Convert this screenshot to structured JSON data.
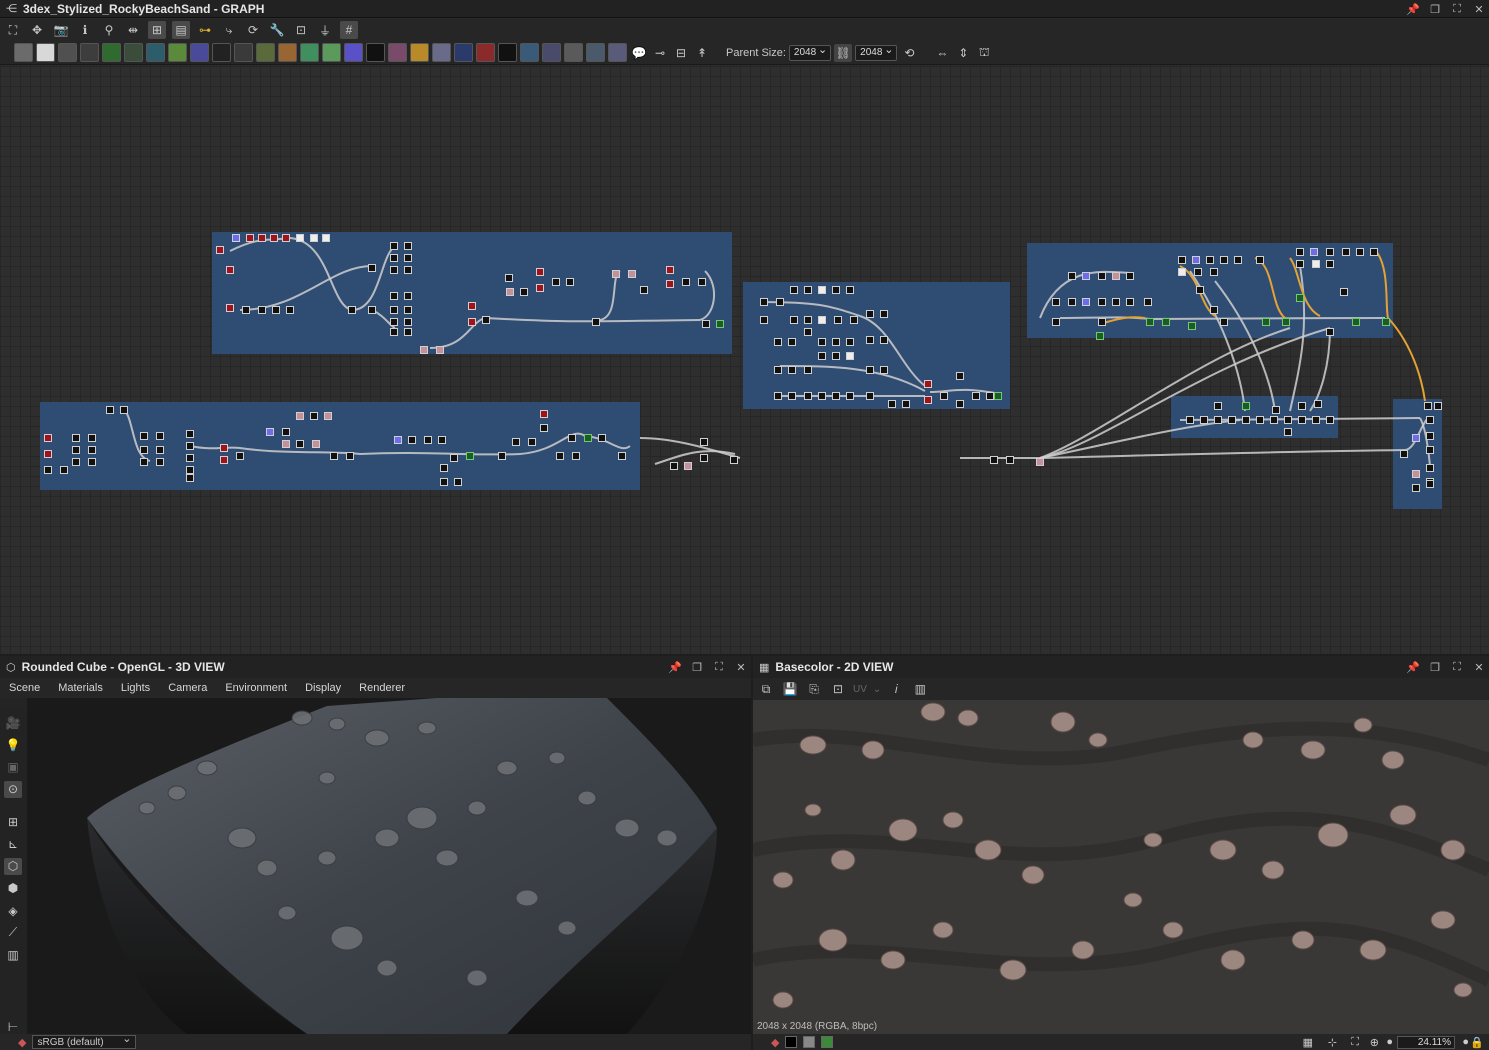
{
  "graph": {
    "title": "3dex_Stylized_RockyBeachSand - GRAPH",
    "parent_size_label": "Parent Size:",
    "parent_size_value": "2048",
    "output_size_value": "2048",
    "toolbar1_icons": [
      "frame-icon",
      "move-icon",
      "camera-icon",
      "info-icon",
      "zoom-icon",
      "align-icon",
      "graph-icon",
      "list-icon",
      "connect-icon",
      "link-icon",
      "refresh-icon",
      "wrench-icon",
      "export-icon",
      "weight-icon",
      "grid-icon"
    ],
    "atom_colors": [
      "#6b6b6b",
      "#d8d8d8",
      "#505050",
      "#3d3d3d",
      "#2f6a2f",
      "#3a4d3a",
      "#2b5d6b",
      "#5a8a3a",
      "#4a4a9a",
      "#222",
      "#3a3a3a",
      "#5a6a3a",
      "#996633",
      "#3f8f5f",
      "#5a9a5a",
      "#5a50c8",
      "#111",
      "#7a4a6a",
      "#b88a2a",
      "#6a6a8a",
      "#2a3a6a",
      "#8a2a2a",
      "#111",
      "#3a5a7a",
      "#4a4a6a",
      "#5a5a5a",
      "#4a5a6a",
      "#5a5a7a"
    ]
  },
  "view3d": {
    "title": "Rounded Cube - OpenGL - 3D VIEW",
    "menu": [
      "Scene",
      "Materials",
      "Lights",
      "Camera",
      "Environment",
      "Display",
      "Renderer"
    ],
    "colorspace": "sRGB (default)"
  },
  "view2d": {
    "title": "Basecolor - 2D VIEW",
    "uv_label": "UV",
    "resolution": "2048 x 2048 (RGBA, 8bpc)",
    "zoom": "24.11%"
  }
}
